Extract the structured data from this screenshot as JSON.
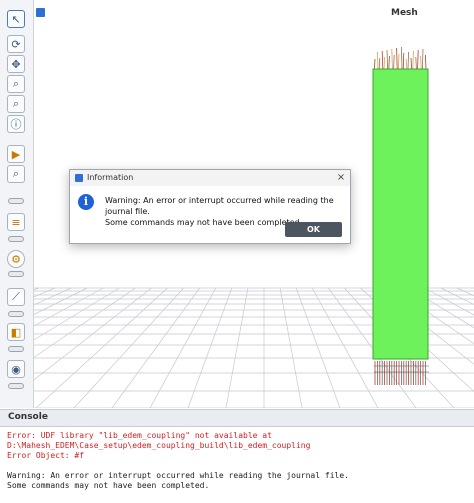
{
  "viewport": {
    "title": "Mesh"
  },
  "toolbar": {
    "tools": [
      {
        "name": "select-arrow-icon",
        "glyph": "↖"
      },
      {
        "name": "rotate-icon",
        "glyph": "⟳"
      },
      {
        "name": "pan-icon",
        "glyph": "✥"
      },
      {
        "name": "zoom-icon",
        "glyph": "⌕"
      },
      {
        "name": "zoom-box-icon",
        "glyph": "⌕"
      },
      {
        "name": "info-probe-icon",
        "glyph": "ⓘ"
      },
      {
        "name": "annotate-icon",
        "glyph": "▶"
      },
      {
        "name": "zoom-fit-icon",
        "glyph": "⌕"
      },
      {
        "name": "layers-icon",
        "glyph": "≡"
      },
      {
        "name": "gear-icon",
        "glyph": "⚙"
      },
      {
        "name": "plot-icon",
        "glyph": "⟋"
      },
      {
        "name": "display-box-icon",
        "glyph": "◧"
      },
      {
        "name": "eye-icon",
        "glyph": "◉"
      }
    ]
  },
  "dialog": {
    "title": "Information",
    "close_glyph": "×",
    "icon_glyph": "i",
    "message_line1": "Warning: An error or interrupt occurred while reading the journal file.",
    "message_line2": "Some commands may not have been completed.",
    "ok_label": "OK"
  },
  "console": {
    "title": "Console",
    "lines": [
      "Error: UDF library \"lib_edem_coupling\" not available at",
      "D:\\Mahesh_EDEM\\Case_setup\\edem_coupling_build\\lib_edem_coupling",
      "Error Object: #f",
      "",
      "Warning: An error or interrupt occurred while reading the journal file.",
      "Some commands may not have been completed."
    ]
  },
  "colors": {
    "mesh_green": "#6ef25c",
    "grid_line": "#c4c8cf",
    "error_red": "#d42020",
    "ok_button": "#4d5560",
    "info_blue": "#1d62d6"
  }
}
